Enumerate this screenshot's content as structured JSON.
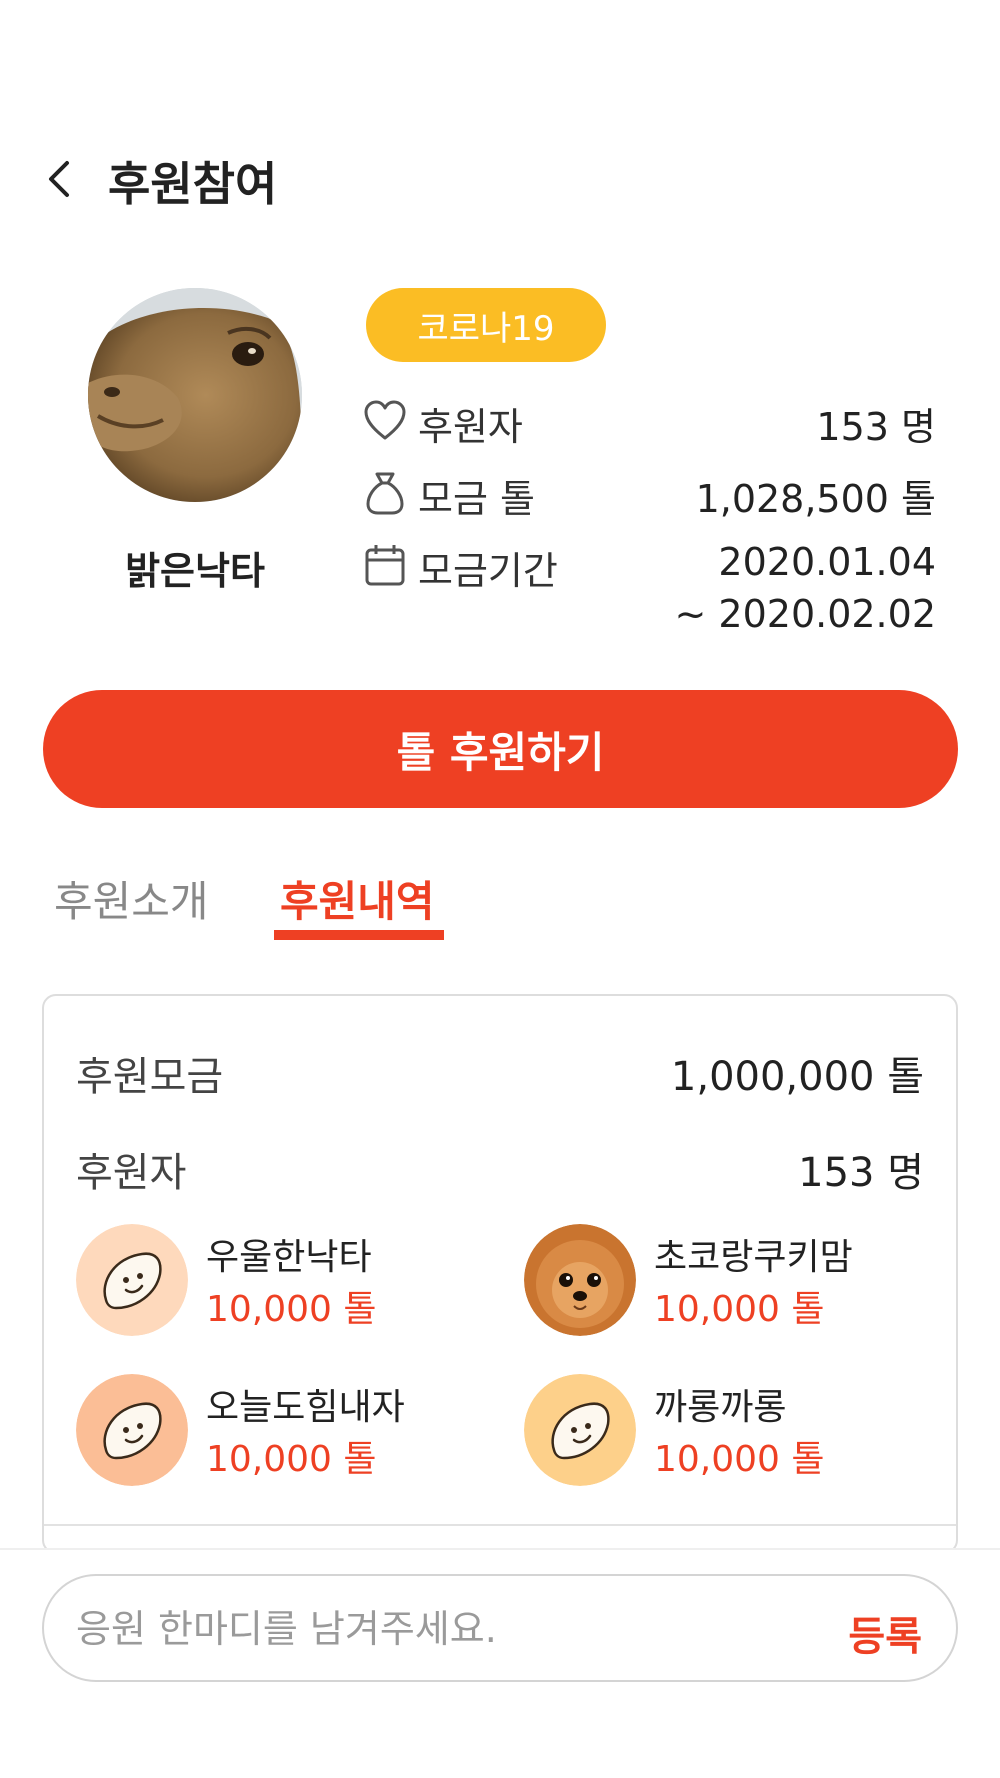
{
  "header": {
    "title": "후원참여",
    "back_icon": "chevron-left-icon"
  },
  "profile": {
    "name": "밝은낙타",
    "tag": "코로나19",
    "tag_color": "#fbbd24"
  },
  "stats": {
    "sponsors_label": "후원자",
    "sponsors_value": "153 명",
    "amount_label": "모금 톨",
    "amount_value": "1,028,500 톨",
    "period_label": "모금기간",
    "period_start": "2020.01.04",
    "period_end": "~ 2020.02.02"
  },
  "donate_button": "톨 후원하기",
  "tabs": [
    {
      "label": "후원소개",
      "active": false
    },
    {
      "label": "후원내역",
      "active": true
    }
  ],
  "history": {
    "total_label": "후원모금",
    "total_value": "1,000,000 톨",
    "sponsors_label": "후원자",
    "sponsors_value": "153 명",
    "donors": [
      {
        "name": "우울한낙타",
        "amount": "10,000 톨"
      },
      {
        "name": "초코랑쿠키맘",
        "amount": "10,000 톨"
      },
      {
        "name": "오늘도힘내자",
        "amount": "10,000 톨"
      },
      {
        "name": "까롱까롱",
        "amount": "10,000 톨"
      }
    ]
  },
  "comment": {
    "placeholder": "응원 한마디를 남겨주세요.",
    "submit_label": "등록"
  },
  "colors": {
    "accent": "#ee4023",
    "tag": "#fbbd24",
    "white": "#ffffff"
  }
}
